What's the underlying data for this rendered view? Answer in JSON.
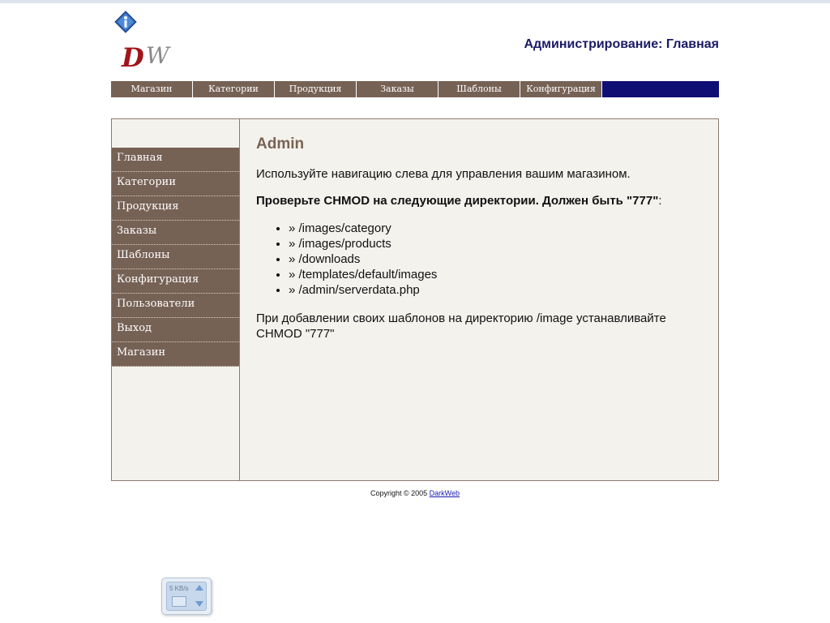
{
  "header": {
    "title": "Администрирование: Главная",
    "logo_text": "DW"
  },
  "topnav": [
    {
      "label": "Магазин"
    },
    {
      "label": "Категории"
    },
    {
      "label": "Продукция"
    },
    {
      "label": "Заказы"
    },
    {
      "label": "Шаблоны"
    },
    {
      "label": "Конфигурация"
    }
  ],
  "sidebar": [
    {
      "label": "Главная"
    },
    {
      "label": "Категории"
    },
    {
      "label": "Продукция"
    },
    {
      "label": "Заказы"
    },
    {
      "label": "Шаблоны"
    },
    {
      "label": "Конфигурация"
    },
    {
      "label": "Пользователи"
    },
    {
      "label": "Выход"
    },
    {
      "label": "Магазин"
    }
  ],
  "main": {
    "heading": "Admin",
    "intro": "Используйте навигацию слева для управления вашим магазином.",
    "chmod_note_bold": "Проверьте CHMOD на следующие директории. Должен быть \"777\"",
    "chmod_note_tail": ":",
    "dirs": [
      "» /images/category",
      "» /images/products",
      "» /downloads",
      "» /templates/default/images",
      "» /admin/serverdata.php"
    ],
    "templates_note": "При добавлении своих шаблонов на директорию /image устанавливайте CHMOD \"777\""
  },
  "footer": {
    "copyright": "Copyright © 2005",
    "link": "DarkWeb"
  },
  "speed_widget": {
    "rate": "5 KB/s"
  },
  "colors": {
    "nav_brown": "#766155",
    "nav_blue": "#0e0e74",
    "title_blue": "#1a1a66",
    "heading_brown": "#7a6353",
    "panel_bg": "#f4f2ed"
  }
}
